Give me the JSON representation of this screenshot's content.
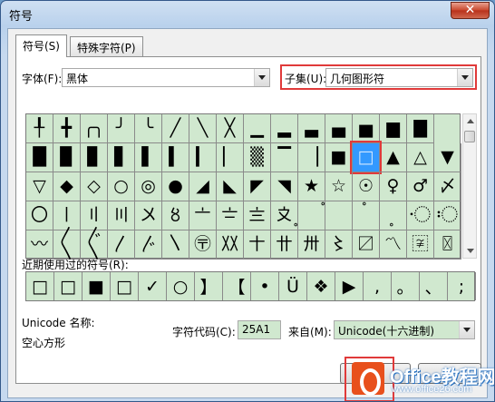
{
  "window": {
    "title": "符号",
    "close_glyph": "✕"
  },
  "tabs": [
    {
      "label": "符号(S)"
    },
    {
      "label": "特殊字符(P)"
    }
  ],
  "font": {
    "label": "字体(F):",
    "value": "黑体"
  },
  "subset": {
    "label": "子集(U):",
    "value": "几何图形符"
  },
  "symbol_grid": [
    [
      "╀",
      "╋",
      "╭╮",
      "╯",
      "╰",
      "╱",
      "╲",
      "╳",
      "▁",
      "▂",
      "▃",
      "▄",
      "▅",
      "▆",
      "▇"
    ],
    [
      "█",
      "▉",
      "▊",
      "▋",
      "▌",
      "▍",
      "▎",
      "▏",
      "▒",
      "▔",
      "▕",
      "■",
      "□",
      "▲",
      "△",
      "▼"
    ],
    [
      "▽",
      "◆",
      "◇",
      "○",
      "◎",
      "●",
      "◢",
      "◣",
      "◤",
      "◥",
      "★",
      "☆",
      "☉",
      "♀",
      "♂",
      "〆"
    ],
    [
      "〇",
      "〡",
      "〢",
      "〣",
      "〤",
      "〥",
      "〦",
      "〧",
      "〨",
      "〩",
      "〪",
      "〫",
      "〬",
      "〭",
      "〮",
      "〯"
    ],
    [
      "〰",
      "〱",
      "〲",
      "〳",
      "〴",
      "〵",
      "〶",
      "〷",
      "〸",
      "〹",
      "〺",
      "〻",
      "〼",
      "〽",
      "〾",
      "〿"
    ]
  ],
  "recent": {
    "label": "近期使用过的符号(R):",
    "items": [
      "□",
      "□",
      "■",
      "□",
      "✓",
      "○",
      "】",
      "【",
      "•",
      "Ü",
      "❖",
      "▶",
      ",",
      "。",
      "、",
      ";"
    ]
  },
  "unicode_name_label": "Unicode 名称:",
  "unicode_name_value": "空心方形",
  "char_code": {
    "label": "字符代码(C):",
    "value": "25A1"
  },
  "from": {
    "label": "来自(M):",
    "value": "Unicode(十六进制)"
  },
  "watermark": {
    "brand": "Office教程网",
    "url": "www.office26.com"
  },
  "colors": {
    "grid_bg": "#d0e8cf",
    "selection": "#3399ff",
    "highlight_red": "#e03a3a"
  }
}
